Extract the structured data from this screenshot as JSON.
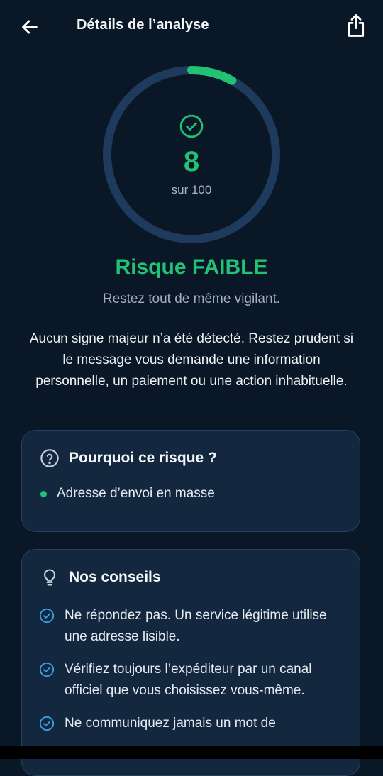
{
  "header": {
    "title": "Détails de l’analyse",
    "back_icon": "arrow-left-icon",
    "share_icon": "share-icon"
  },
  "score": {
    "value": "8",
    "of_label": "sur 100",
    "fraction": 0.08,
    "color": "#22c274",
    "track_color": "#1e3a5c",
    "icon": "check-circle-icon"
  },
  "risk": {
    "level": "Risque FAIBLE",
    "subtitle": "Restez tout de même vigilant.",
    "description": "Aucun signe majeur n’a été détecté. Restez prudent si le message vous demande une information personnelle, un paiement ou une action inhabituelle."
  },
  "why_card": {
    "title": "Pourquoi ce risque ?",
    "icon": "help-circle-icon",
    "reasons": [
      "Adresse d’envoi en masse"
    ]
  },
  "tips_card": {
    "title": "Nos conseils",
    "icon": "lightbulb-icon",
    "items": [
      "Ne répondez pas. Un service légitime utilise une adresse lisible.",
      "Vérifiez toujours l’expéditeur par un canal officiel que vous choisissez vous-même.",
      "Ne communiquez jamais un mot de"
    ]
  },
  "colors": {
    "background": "#0a1726",
    "accent_green": "#22c274",
    "accent_blue": "#3aa0e6",
    "card_bg": "#13283f"
  }
}
